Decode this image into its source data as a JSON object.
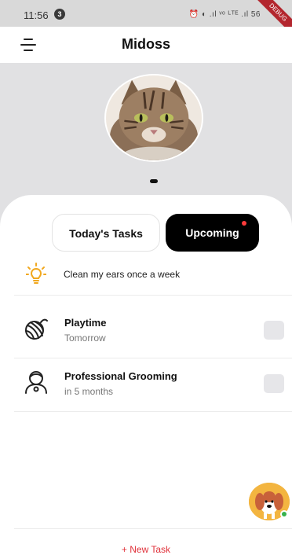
{
  "status_bar": {
    "time": "11:56",
    "notification_count": "3",
    "icons_text": "⏰ ◐ .ıl ᵛᵒ ᴸᵀᴱ .ıl 56",
    "debug_label": "DEBUG"
  },
  "app_bar": {
    "title": "Midoss",
    "menu_icon": "menu-icon"
  },
  "tabs": {
    "today_label": "Today's Tasks",
    "upcoming_label": "Upcoming",
    "active": "upcoming"
  },
  "tip": {
    "icon": "lightbulb-icon",
    "text": "Clean my ears once a week"
  },
  "tasks": [
    {
      "title": "Playtime",
      "subtitle": "Tomorrow",
      "icon": "yarn-ball-icon"
    },
    {
      "title": "Professional Grooming",
      "subtitle": "in 5 months",
      "icon": "groomer-icon"
    }
  ],
  "new_task_label": "+ New Task",
  "colors": {
    "accent": "#e0313a",
    "active_tab_bg": "#000000",
    "tip_icon": "#f1a81f",
    "hero_bg": "#e1e1e3",
    "online": "#37b24d"
  }
}
